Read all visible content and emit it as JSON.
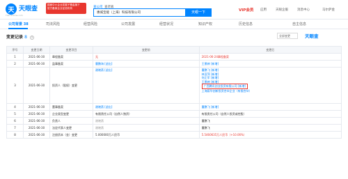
{
  "header": {
    "logo_mark": "天",
    "logo_text": "天眼查",
    "logo_sub": "TianYanCha.com",
    "promo_line1": "国家中小企业发展子基金旗下",
    "promo_line2": "官方备案企业征信机构",
    "search_type_active": "查公司",
    "search_type_other": "查老板",
    "search_value": "惠城宝能（上海）科技有限公司",
    "search_button": "天眼一下",
    "vip_label": "VIP会员",
    "nav": [
      "应用",
      "天眼企服",
      "消息中心",
      "马尔萨金"
    ]
  },
  "tabs": [
    {
      "label": "公司背景",
      "count": "38"
    },
    {
      "label": "司法风险"
    },
    {
      "label": "经营风险"
    },
    {
      "label": "公司发展"
    },
    {
      "label": "经营状况"
    },
    {
      "label": "知识产权"
    },
    {
      "label": "历史信息"
    },
    {
      "label": "自主信息"
    }
  ],
  "section": {
    "title": "变更记录",
    "count": "8",
    "filter": "全部变更",
    "brand": "天眼查"
  },
  "table": {
    "columns": [
      "序号",
      "变更日期",
      "变更项目",
      "变更前",
      "变更后"
    ],
    "rows": [
      {
        "idx": "1",
        "date": "2021-06-30",
        "item": "章程备案",
        "before": [
          "无"
        ],
        "after": [
          "2021-06-24章程备案"
        ]
      },
      {
        "idx": "2",
        "date": "2021-06-30",
        "item": "监事备案",
        "before": [
          "曹鹏海 [退出]"
        ],
        "after": [
          "王景婷 [新增]"
        ]
      },
      {
        "idx": "3",
        "date": "2021-06-30",
        "item": "投资人（股权）变更",
        "before": [
          "谢晓燕 [退出]"
        ],
        "after": [
          "曹鹏飞 [新增]",
          "林亚萍 [新增]",
          "何正军 [新增]",
          "王景婷 [新增]",
          "广西腾讯创业投资有限公司 [新增]",
          "上海蔚华创新投资合伙企业（有限合伙）"
        ]
      },
      {
        "idx": "4",
        "date": "2021-06-30",
        "item": "董事备案",
        "before": [
          "谢晓燕 [退出]"
        ],
        "after": [
          "曹鹏飞 [新增]"
        ]
      },
      {
        "idx": "5",
        "date": "2021-06-30",
        "item": "企业类型变更",
        "before": [
          "有限责任公司（自然人独资）"
        ],
        "after": [
          "有限责任公司（自然人投资或控股）"
        ]
      },
      {
        "idx": "6",
        "date": "2021-06-30",
        "item": "负责人",
        "before": [
          "谢晓燕"
        ],
        "after": [
          "曹鹏飞"
        ]
      },
      {
        "idx": "7",
        "date": "2021-06-30",
        "item": "法定代表人变更",
        "before": [
          "谢晓燕"
        ],
        "after": [
          "曹鹏飞"
        ]
      },
      {
        "idx": "8",
        "date": "2021-06-30",
        "item": "注册资本（金）变更",
        "before": [
          "5.000000万人民币"
        ],
        "after": [
          "5.5460635万人民币（+10.06%）"
        ]
      }
    ]
  }
}
